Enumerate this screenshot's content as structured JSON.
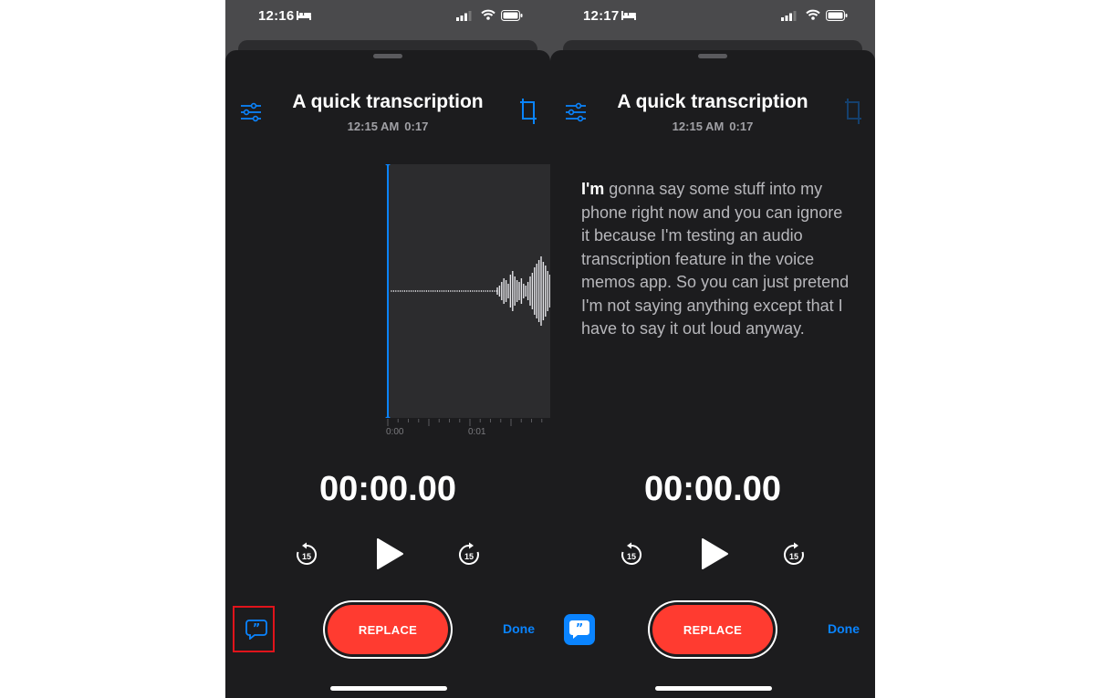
{
  "left_phone": {
    "status_time": "12:16",
    "title": "A quick transcription",
    "meta_time": "12:15 AM",
    "meta_duration": "0:17",
    "timeline_label_0": "0:00",
    "timeline_label_1": "0:01",
    "timer": "00:00.00",
    "skip_back_label": "15",
    "skip_forward_label": "15",
    "replace_label": "REPLACE",
    "done_label": "Done",
    "transcript_button_active": false
  },
  "right_phone": {
    "status_time": "12:17",
    "title": "A quick transcription",
    "meta_time": "12:15 AM",
    "meta_duration": "0:17",
    "transcript_highlight": "I'm",
    "transcript_rest": " gonna say some stuff into my phone right now and you can ignore it because I'm testing an audio transcription feature in the voice memos app. So you can just pretend I'm not saying anything except that I have to say it out loud anyway.",
    "timer": "00:00.00",
    "skip_back_label": "15",
    "skip_forward_label": "15",
    "replace_label": "REPLACE",
    "done_label": "Done",
    "transcript_button_active": true
  },
  "colors": {
    "accent": "#0a84ff",
    "record": "#ff3b30",
    "sheet": "#1c1c1e",
    "highlight_box": "#e0141b"
  },
  "icons": [
    "bed-icon",
    "signal-icon",
    "wifi-icon",
    "battery-icon",
    "settings-sliders-icon",
    "crop-icon",
    "skip-back-15-icon",
    "play-icon",
    "skip-forward-15-icon",
    "transcript-quote-icon"
  ]
}
